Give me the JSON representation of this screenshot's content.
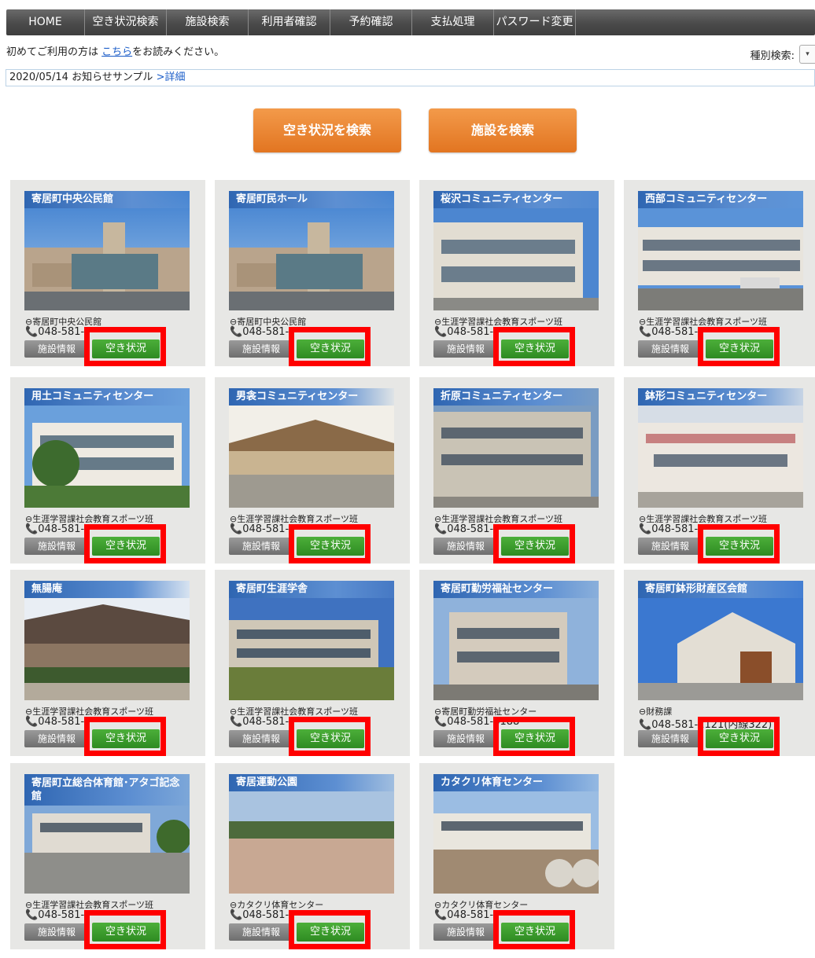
{
  "nav": [
    "HOME",
    "空き状況検索",
    "施設検索",
    "利用者確認",
    "予約確認",
    "支払処理",
    "パスワード変更"
  ],
  "intro": {
    "before": "初めてご利用の方は ",
    "link": "こちら",
    "after": "をお読みください。"
  },
  "kind_search": {
    "label": "種別検索:",
    "arrow": "▾"
  },
  "notice": {
    "date": "2020/05/14",
    "text": "お知らせサンプル",
    "detail": ">詳細"
  },
  "buttons": {
    "search_availability": "空き状況を検索",
    "search_facility": "施設を検索"
  },
  "facility_info_label": "施設情報",
  "availability_label": "空き状況",
  "owner_icon": "⊖",
  "phone_icon": "📞",
  "facilities": [
    {
      "name": "寄居町中央公民館",
      "owner": "寄居町中央公民館",
      "phone": "048-581-"
    },
    {
      "name": "寄居町民ホール",
      "owner": "寄居町中央公民館",
      "phone": "048-581-"
    },
    {
      "name": "桜沢コミュニティセンター",
      "owner": "生涯学習課社会教育スポーツ班",
      "phone": "048-581-"
    },
    {
      "name": "西部コミュニティセンター",
      "owner": "生涯学習課社会教育スポーツ班",
      "phone": "048-581-"
    },
    {
      "name": "用土コミュニティセンター",
      "owner": "生涯学習課社会教育スポーツ班",
      "phone": "048-581-"
    },
    {
      "name": "男衾コミュニティセンター",
      "owner": "生涯学習課社会教育スポーツ班",
      "phone": "048-581-"
    },
    {
      "name": "折原コミュニティセンター",
      "owner": "生涯学習課社会教育スポーツ班",
      "phone": "048-581-"
    },
    {
      "name": "鉢形コミュニティセンター",
      "owner": "生涯学習課社会教育スポーツ班",
      "phone": "048-581-"
    },
    {
      "name": "無腸庵",
      "owner": "生涯学習課社会教育スポーツ班",
      "phone": "048-581-"
    },
    {
      "name": "寄居町生涯学舎",
      "owner": "生涯学習課社会教育スポーツ班",
      "phone": "048-581-"
    },
    {
      "name": "寄居町勤労福祉センター",
      "owner": "寄居町勤労福祉センター",
      "phone": "048-581-6188"
    },
    {
      "name": "寄居町鉢形財産区会館",
      "owner": "財務課",
      "phone": "048-581-2121(内線322)"
    },
    {
      "name": "寄居町立総合体育館･アタゴ記念館",
      "owner": "生涯学習課社会教育スポーツ班",
      "phone": "048-581-"
    },
    {
      "name": "寄居運動公園",
      "owner": "カタクリ体育センター",
      "phone": "048-581-"
    },
    {
      "name": "カタクリ体育センター",
      "owner": "カタクリ体育センター",
      "phone": "048-581-"
    }
  ]
}
